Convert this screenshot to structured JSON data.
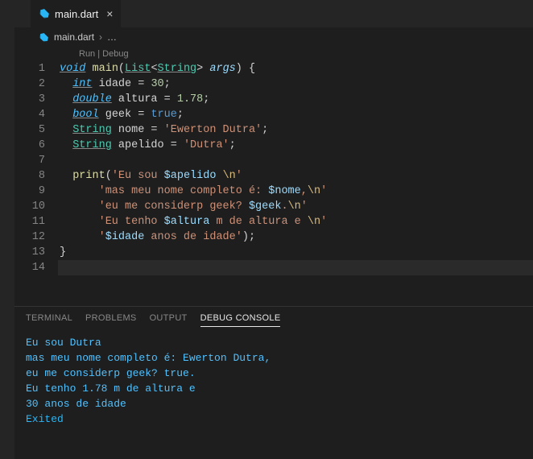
{
  "tab": {
    "filename": "main.dart"
  },
  "breadcrumb": {
    "filename": "main.dart",
    "ellipsis": "…"
  },
  "codelens": {
    "text": "Run | Debug"
  },
  "gutter": [
    "1",
    "2",
    "3",
    "4",
    "5",
    "6",
    "7",
    "8",
    "9",
    "10",
    "11",
    "12",
    "13",
    "14"
  ],
  "code": {
    "l1": {
      "void": "void",
      "main": "main",
      "List": "List",
      "String": "String",
      "args": "args",
      "open": " ",
      "p1": "(",
      "lt": "<",
      "gt": ">",
      "p2": ") {",
      "sp": " "
    },
    "l2": {
      "int": "int",
      "idade": "idade",
      "eq": " = ",
      "n": "30",
      "sc": ";"
    },
    "l3": {
      "double": "double",
      "altura": "altura",
      "eq": " = ",
      "n": "1.78",
      "sc": ";"
    },
    "l4": {
      "bool": "bool",
      "geek": "geek",
      "eq": " = ",
      "v": "true",
      "sc": ";"
    },
    "l5": {
      "String": "String",
      "nome": "nome",
      "eq": " = ",
      "v": "'Ewerton Dutra'",
      "sc": ";"
    },
    "l6": {
      "String": "String",
      "apelido": "apelido",
      "eq": " = ",
      "v": "'Dutra'",
      "sc": ";"
    },
    "l8": {
      "print": "print",
      "p1": "(",
      "s1": "'Eu sou ",
      "i1": "$apelido",
      "sp": " ",
      "e": "\\n",
      "s2": "'"
    },
    "l9": {
      "s1": "'mas meu nome completo é: ",
      "i1": "$nome",
      "s2": ",",
      "e": "\\n",
      "s3": "'"
    },
    "l10": {
      "s1": "'eu me considerp geek? ",
      "i1": "$geek",
      "s2": ".",
      "e": "\\n",
      "s3": "'"
    },
    "l11": {
      "s1": "'Eu tenho ",
      "i1": "$altura",
      "s2": " m de altura e ",
      "e": "\\n",
      "s3": "'"
    },
    "l12": {
      "s1": "'",
      "i1": "$idade",
      "s2": " anos de idade'",
      "p2": ")",
      "sc": ";"
    },
    "l13": {
      "c": "}"
    }
  },
  "panel": {
    "tabs": {
      "terminal": "TERMINAL",
      "problems": "PROBLEMS",
      "output": "OUTPUT",
      "debug": "DEBUG CONSOLE"
    },
    "lines": [
      "Eu sou Dutra",
      "mas meu nome completo é: Ewerton Dutra,",
      "eu me considerp geek? true.",
      "Eu tenho 1.78 m de altura e",
      "30 anos de idade",
      "Exited"
    ]
  }
}
